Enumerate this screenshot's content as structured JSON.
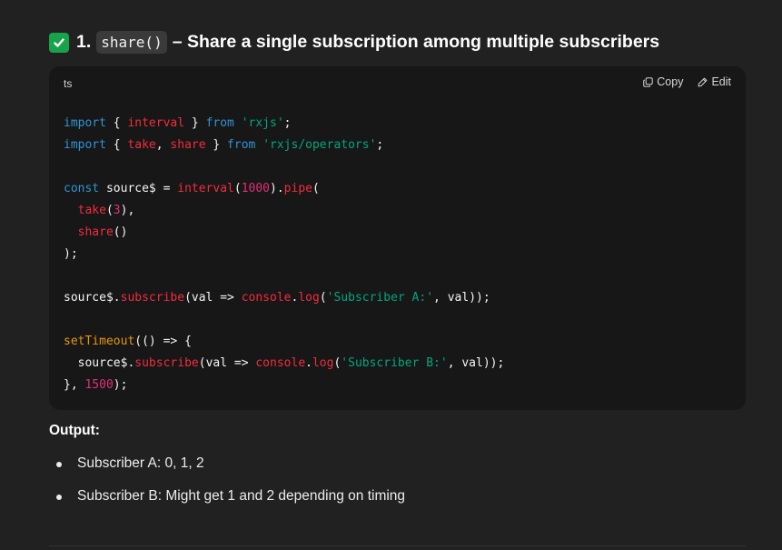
{
  "heading": {
    "icon": "check-mark-icon",
    "number": "1.",
    "code": "share()",
    "text": "– Share a single subscription among multiple subscribers"
  },
  "code_block": {
    "language": "ts",
    "copy_label": "Copy",
    "edit_label": "Edit",
    "lines": [
      "import { interval } from 'rxjs';",
      "import { take, share } from 'rxjs/operators';",
      "",
      "const source$ = interval(1000).pipe(",
      "  take(3),",
      "  share()",
      ");",
      "",
      "source$.subscribe(val => console.log('Subscriber A:', val));",
      "",
      "setTimeout(() => {",
      "  source$.subscribe(val => console.log('Subscriber B:', val));",
      "}, 1500);"
    ]
  },
  "output": {
    "label": "Output:",
    "items": [
      "Subscriber A: 0, 1, 2",
      "Subscriber B: Might get 1 and 2 depending on timing"
    ]
  },
  "colors": {
    "background": "#212121",
    "code_background": "#171717",
    "keyword": "#2e95d3",
    "string": "#00a67d",
    "function": "#f22c3d",
    "number": "#df3079",
    "object": "#e9950c",
    "check_green": "#16a34a"
  }
}
